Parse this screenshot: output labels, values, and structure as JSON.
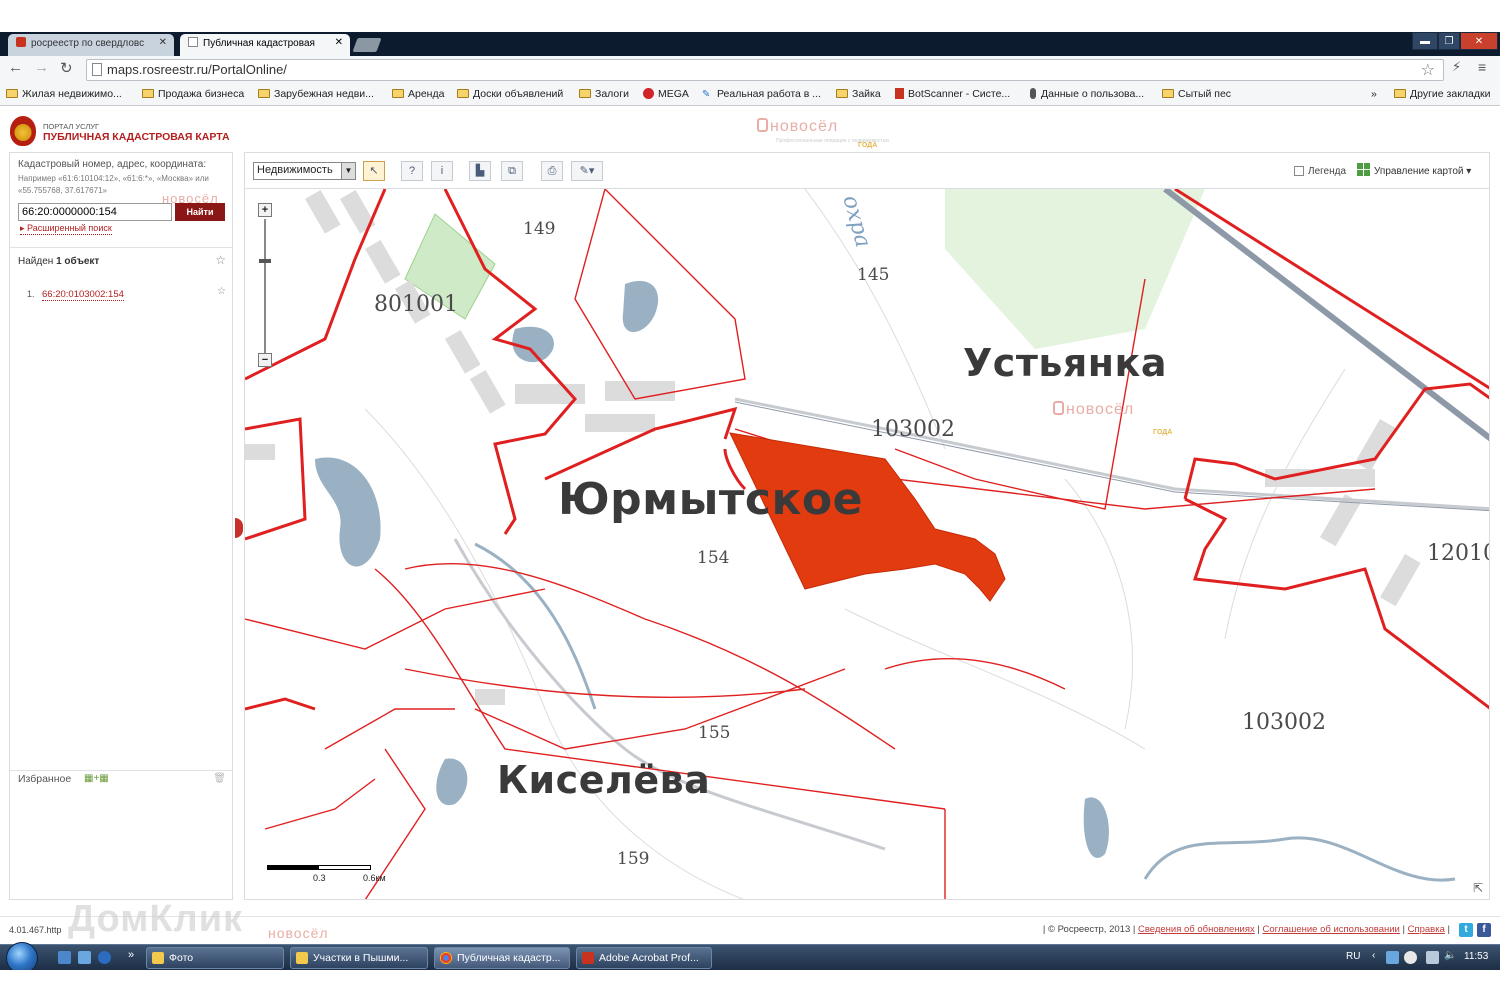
{
  "browser": {
    "tabs": [
      {
        "title": "росреестр по свердловс",
        "active": false
      },
      {
        "title": "Публичная кадастровая",
        "active": true
      }
    ],
    "url": "maps.rosreestr.ru/PortalOnline/",
    "bookmarks": [
      "Жилая недвижимо...",
      "Продажа бизнеса",
      "Зарубежная недви...",
      "Аренда",
      "Доски объявлений",
      "Залоги",
      "MEGA",
      "Реальная работа в ...",
      "Зайка",
      "BotScanner - Систе...",
      "Данные о пользова...",
      "Сытый пес"
    ],
    "more_bookmarks": "Другие закладки",
    "overflow": "»"
  },
  "portal": {
    "line1": "ПОРТАЛ УСЛУГ",
    "line2": "ПУБЛИЧНАЯ КАДАСТРОВАЯ КАРТА"
  },
  "watermark": {
    "brand": "новосёл",
    "sub": "Профессиональные операции с недвижимостью",
    "year": "ГОДА",
    "domclick": "ДомКлик"
  },
  "search": {
    "label": "Кадастровый номер, адрес, координата:",
    "example": "Например «61:6:10104:12», «61:6:*», «Москва» или «55.755768, 37.617671»",
    "value": "66:20:0000000:154",
    "button": "Найти",
    "advanced": "Расширенный поиск"
  },
  "results": {
    "found_prefix": "Найден",
    "found_count": "1 объект",
    "items": [
      {
        "num": "1.",
        "link": "66:20:0103002:154"
      }
    ]
  },
  "favorites": {
    "label": "Избранное"
  },
  "toolbar": {
    "layer": "Недвижимость",
    "legend": "Легенда",
    "map_control": "Управление картой"
  },
  "map": {
    "places": [
      "Юрмытское",
      "Устьянка",
      "Киселёва"
    ],
    "cadastral_labels": [
      "149",
      "145",
      "801001",
      "103002",
      "154",
      "103002",
      "155",
      "159",
      "12010"
    ],
    "river_label": "охра",
    "scale": {
      "mid": "0.3",
      "end": "0.6км"
    },
    "colors": {
      "boundary": "#e02020",
      "selected": "#e23b10",
      "water": "#9ab1c4",
      "forest": "#d6efd0"
    }
  },
  "footer": {
    "version": "4.01.467.http",
    "copyright": "| © Росреестр, 2013 |",
    "links": [
      "Сведения об обновлениях",
      "Соглашение об использовании",
      "Справка"
    ]
  },
  "taskbar": {
    "items": [
      "Фото",
      "Участки в Пышми...",
      "Публичная кадастр...",
      "Adobe Acrobat Prof..."
    ],
    "lang": "RU",
    "time": "11:53"
  }
}
